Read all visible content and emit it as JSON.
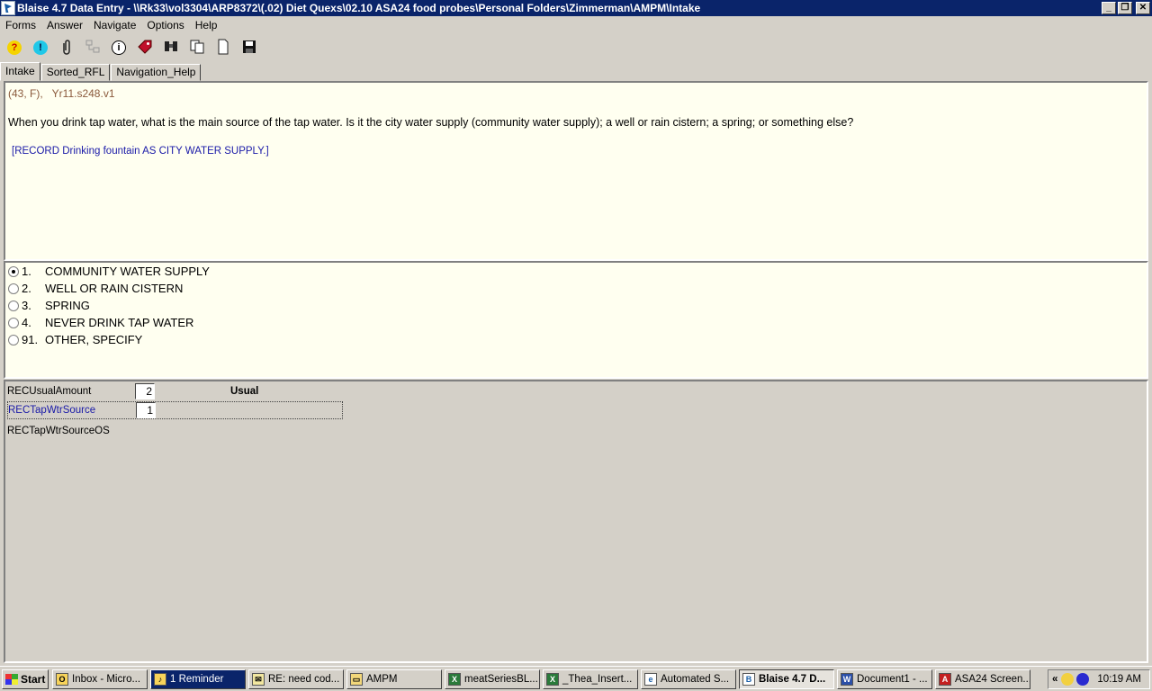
{
  "window": {
    "title": "Blaise 4.7 Data Entry - \\\\Rk33\\vol3304\\ARP8372\\(.02) Diet Quexs\\02.10 ASA24 food probes\\Personal Folders\\Zimmerman\\AMPM\\Intake",
    "minimize": "_",
    "restore": "❐",
    "close": "✕"
  },
  "menu": [
    "Forms",
    "Answer",
    "Navigate",
    "Options",
    "Help"
  ],
  "toolbar": [
    {
      "icon": "help-question-icon",
      "glyph": "?"
    },
    {
      "icon": "alert-icon",
      "glyph": "!"
    },
    {
      "icon": "paperclip-icon",
      "glyph": "📎"
    },
    {
      "icon": "network-icon",
      "glyph": "⚙"
    },
    {
      "icon": "info-icon",
      "glyph": "i"
    },
    {
      "icon": "tag-icon",
      "glyph": "◆"
    },
    {
      "icon": "binoculars-icon",
      "glyph": "⚲"
    },
    {
      "icon": "copy-icon",
      "glyph": "❐"
    },
    {
      "icon": "new-document-icon",
      "glyph": "□"
    },
    {
      "icon": "save-icon",
      "glyph": "▣"
    }
  ],
  "tabs": [
    "Intake",
    "Sorted_RFL",
    "Navigation_Help"
  ],
  "question": {
    "meta_left": "(43, F),",
    "meta_right": "Yr11.s248.v1",
    "text": "When you drink tap water, what is the main source of the tap water. Is it the city water supply (community water supply); a well or rain cistern; a spring; or something else?",
    "instruction": "[RECORD Drinking fountain AS CITY WATER SUPPLY.]"
  },
  "answers": [
    {
      "code": "1.",
      "label": "COMMUNITY WATER SUPPLY",
      "selected": true
    },
    {
      "code": "2.",
      "label": "WELL OR RAIN CISTERN",
      "selected": false
    },
    {
      "code": "3.",
      "label": "SPRING",
      "selected": false
    },
    {
      "code": "4.",
      "label": "NEVER DRINK TAP WATER",
      "selected": false
    },
    {
      "code": "91.",
      "label": "OTHER, SPECIFY",
      "selected": false
    }
  ],
  "form": [
    {
      "name": "RECUsualAmount",
      "value": "2",
      "label": "Usual"
    },
    {
      "name": "RECTapWtrSource",
      "value": "1",
      "label": ""
    },
    {
      "name": "RECTapWtrSourceOS",
      "value": "",
      "label": ""
    }
  ],
  "taskbar": {
    "start": "Start",
    "items": [
      {
        "label": "Inbox - Micro...",
        "icon": "outlook-icon",
        "glyph": "O"
      },
      {
        "label": "1 Reminder",
        "icon": "bell-icon",
        "glyph": "♪"
      },
      {
        "label": "RE: need cod...",
        "icon": "mail-icon",
        "glyph": "✉"
      },
      {
        "label": "AMPM",
        "icon": "folder-icon",
        "glyph": "▭"
      },
      {
        "label": "meatSeriesBL...",
        "icon": "excel-icon",
        "glyph": "X"
      },
      {
        "label": "_Thea_Insert...",
        "icon": "excel-icon",
        "glyph": "X"
      },
      {
        "label": "Automated S...",
        "icon": "ie-icon",
        "glyph": "e"
      },
      {
        "label": "Blaise 4.7 D...",
        "icon": "blaise-icon",
        "glyph": "B"
      },
      {
        "label": "Document1 - ...",
        "icon": "word-icon",
        "glyph": "W"
      },
      {
        "label": "ASA24 Screen...",
        "icon": "pdf-icon",
        "glyph": "A"
      }
    ],
    "clock": "10:19 AM",
    "tray_expand": "«"
  }
}
